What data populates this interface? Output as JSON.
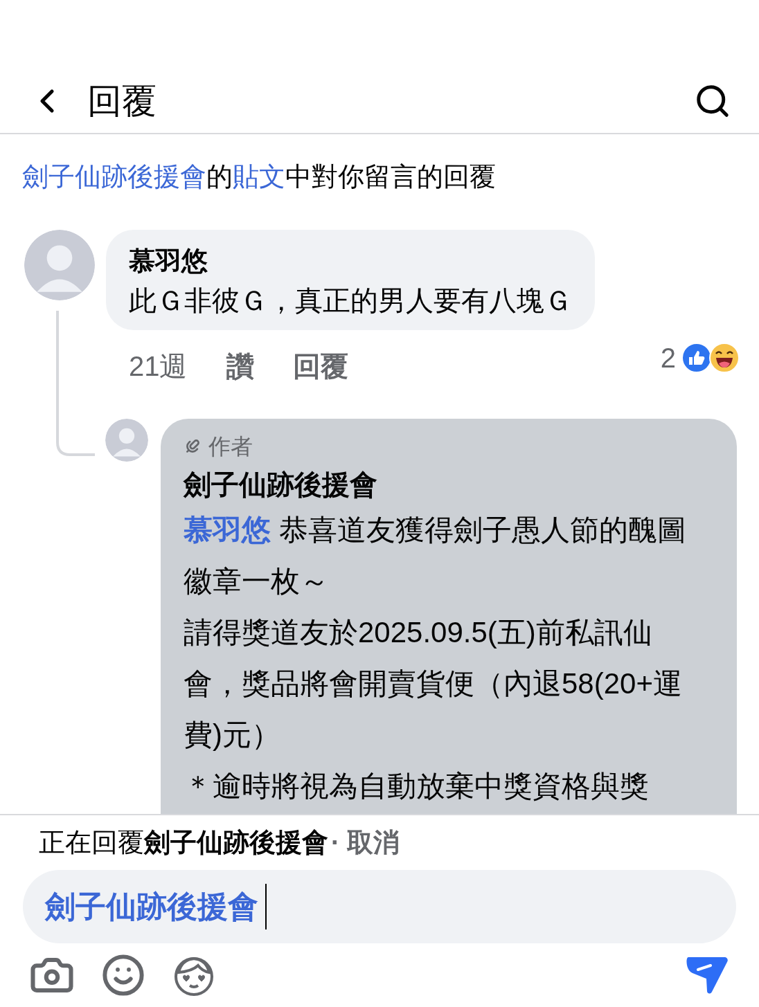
{
  "header": {
    "title": "回覆"
  },
  "context": {
    "page": "劍子仙跡後援會",
    "connector": "的",
    "post": "貼文",
    "rest": "中對你留言的回覆"
  },
  "comment": {
    "author": "慕羽悠",
    "text": "此Ｇ非彼Ｇ，真正的男人要有八塊Ｇ",
    "time": "21週",
    "like": "讚",
    "reply": "回覆",
    "reaction_count": "2"
  },
  "reply": {
    "badge": "作者",
    "author": "劍子仙跡後援會",
    "mention": "慕羽悠",
    "paragraphs": [
      "恭喜道友獲得劍子愚人節的醜圖徽章一枚～",
      "請得獎道友於2025.09.5(五)前私訊仙會，獎品將會開賣貨便（內退58(20+運費)元）",
      "＊逾時將視為自動放棄中獎資格與獎"
    ]
  },
  "replying_bar": {
    "prefix": "正在回覆",
    "name": "劍子仙跡後援會",
    "cancel": "· 取消"
  },
  "composer": {
    "value": "劍子仙跡後援會"
  }
}
